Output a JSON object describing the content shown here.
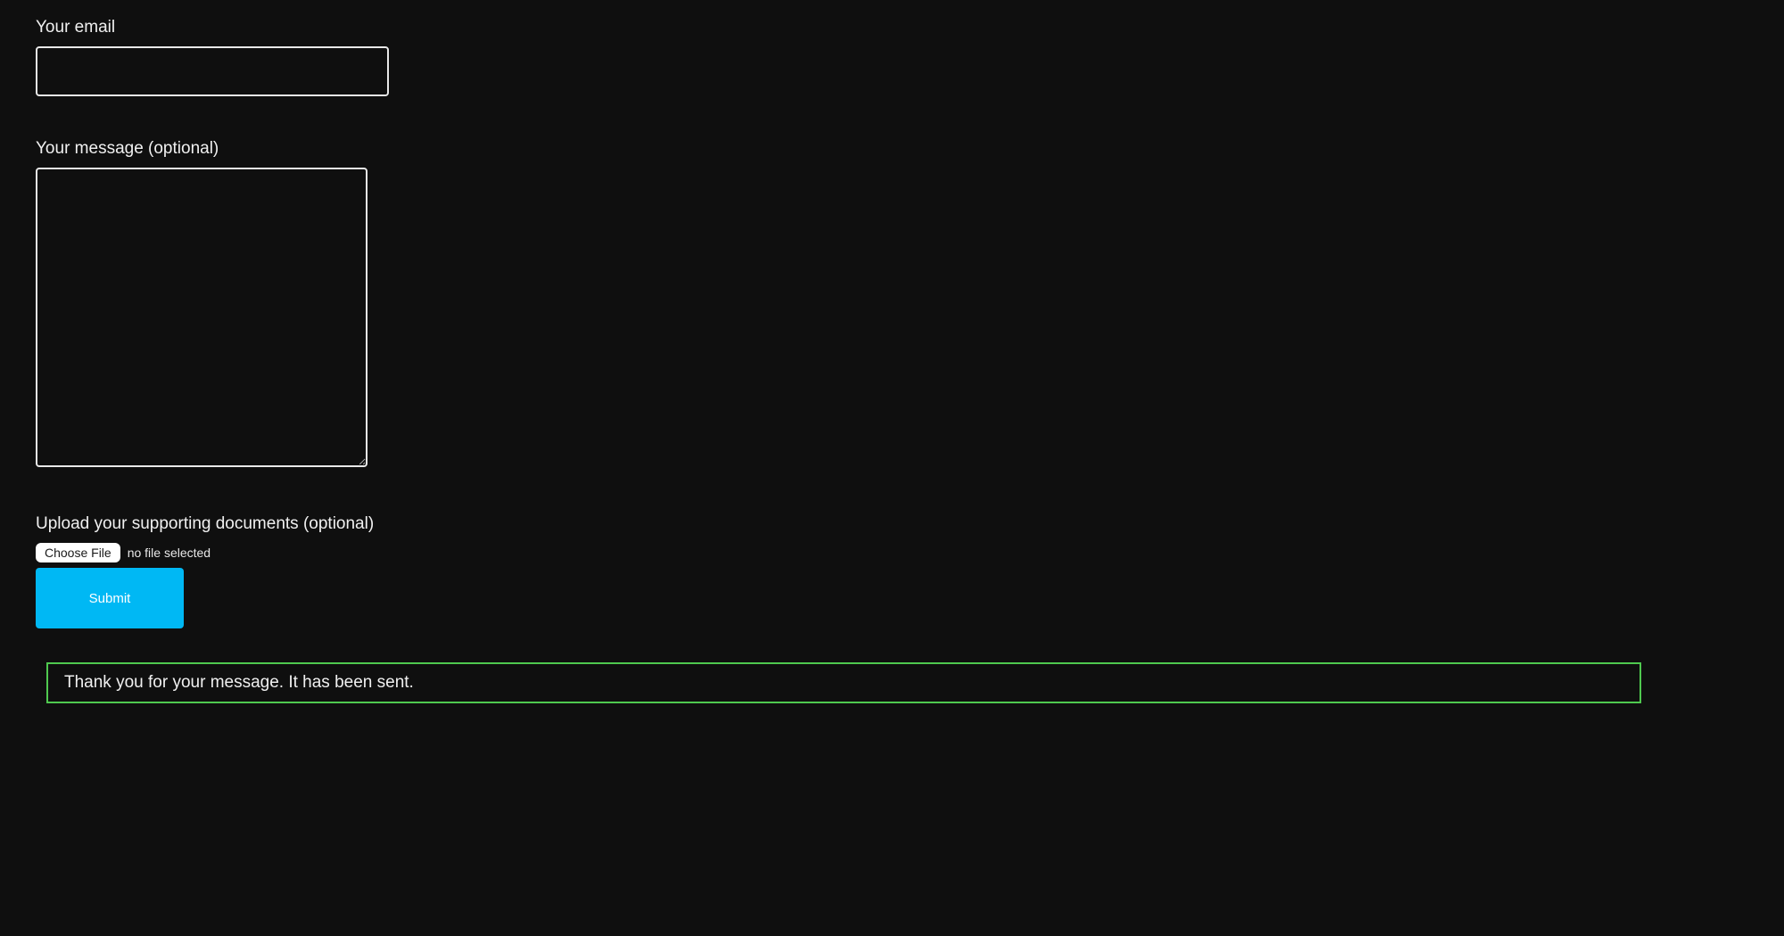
{
  "form": {
    "email": {
      "label": "Your email",
      "value": ""
    },
    "message": {
      "label": "Your message (optional)",
      "value": ""
    },
    "upload": {
      "label": "Upload your supporting documents (optional)",
      "choose_button": "Choose File",
      "status": "no file selected"
    },
    "submit_label": "Submit"
  },
  "notification": {
    "success_text": "Thank you for your message. It has been sent."
  }
}
